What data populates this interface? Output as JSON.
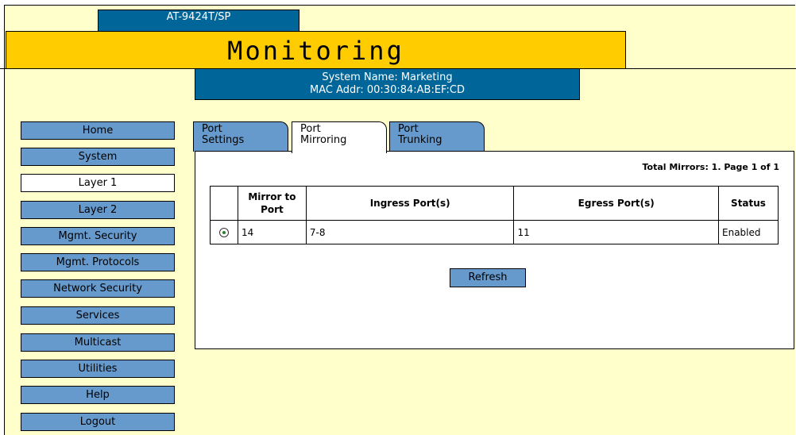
{
  "header": {
    "model": "AT-9424T/SP",
    "title": "Monitoring",
    "system_name": "System Name: Marketing",
    "mac_addr": "MAC Addr: 00:30:84:AB:EF:CD"
  },
  "sidebar": {
    "items": [
      {
        "label": "Home"
      },
      {
        "label": "System"
      },
      {
        "label": "Layer 1"
      },
      {
        "label": "Layer 2"
      },
      {
        "label": "Mgmt. Security"
      },
      {
        "label": "Mgmt. Protocols"
      },
      {
        "label": "Network Security"
      },
      {
        "label": "Services"
      },
      {
        "label": "Multicast"
      },
      {
        "label": "Utilities"
      },
      {
        "label": "Help"
      },
      {
        "label": "Logout"
      }
    ],
    "active": "Layer 1"
  },
  "tabs": [
    {
      "line1": "Port",
      "line2": "Settings"
    },
    {
      "line1": "Port",
      "line2": "Mirroring"
    },
    {
      "line1": "Port",
      "line2": "Trunking"
    }
  ],
  "active_tab": "Port Mirroring",
  "panel": {
    "total": "Total Mirrors: 1. Page 1 of 1",
    "columns": {
      "mirror_line1": "Mirror to",
      "mirror_line2": "Port",
      "ingress": "Ingress Port(s)",
      "egress": "Egress Port(s)",
      "status": "Status"
    },
    "rows": [
      {
        "selected": true,
        "mirror": "14",
        "ingress": "7-8",
        "egress": "11",
        "status": "Enabled"
      }
    ],
    "refresh_label": "Refresh"
  },
  "colors": {
    "background": "#ffffcc",
    "title_bar": "#ffcc00",
    "header_blue": "#006699",
    "button_blue": "#6699cc",
    "radio_selected": "#2e7d2e"
  }
}
